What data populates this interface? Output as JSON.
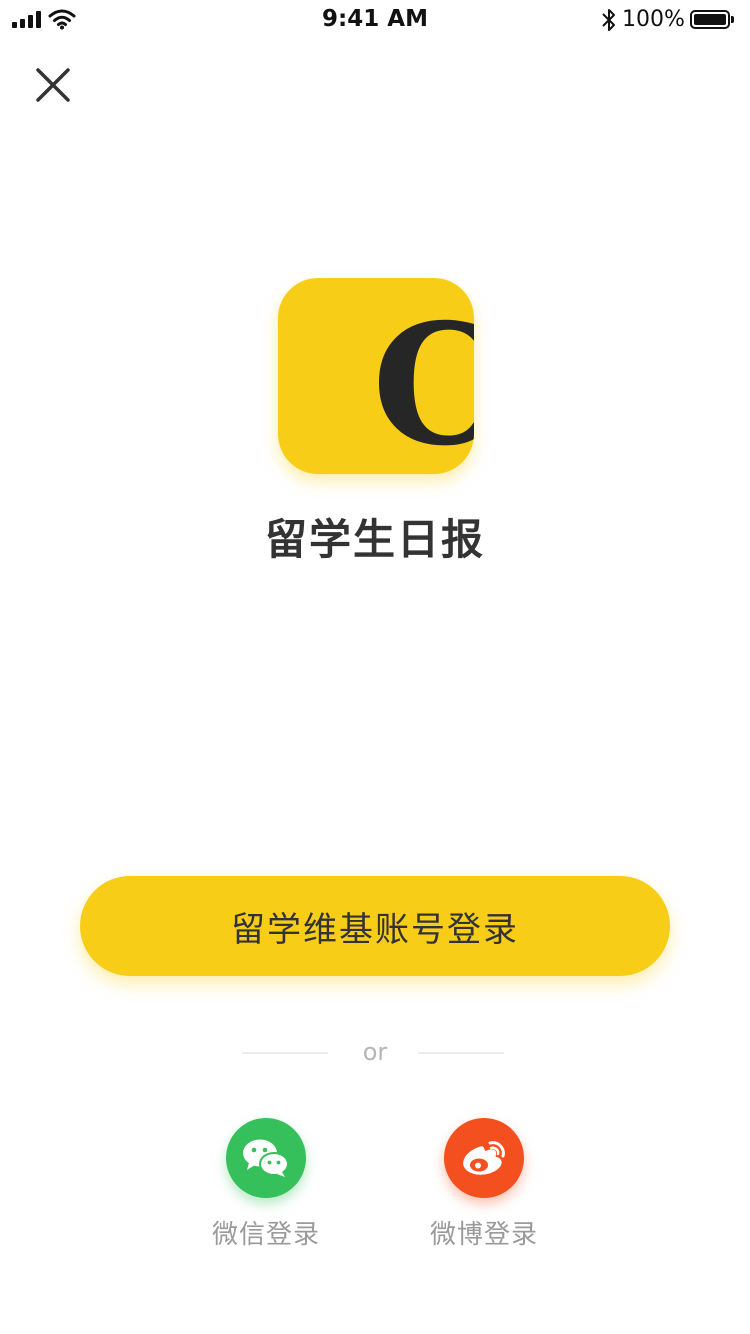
{
  "status_bar": {
    "time": "9:41 AM",
    "battery_percent": "100%"
  },
  "app": {
    "logo_letter": "C",
    "name": "留学生日报"
  },
  "login": {
    "primary_label": "留学维基账号登录",
    "divider_text": "or",
    "social": [
      {
        "label": "微信登录",
        "icon": "wechat-icon"
      },
      {
        "label": "微博登录",
        "icon": "weibo-icon"
      }
    ]
  },
  "colors": {
    "brand_yellow": "#F8CD18",
    "wechat_green": "#35C05B",
    "weibo_orange": "#F44F1E"
  }
}
